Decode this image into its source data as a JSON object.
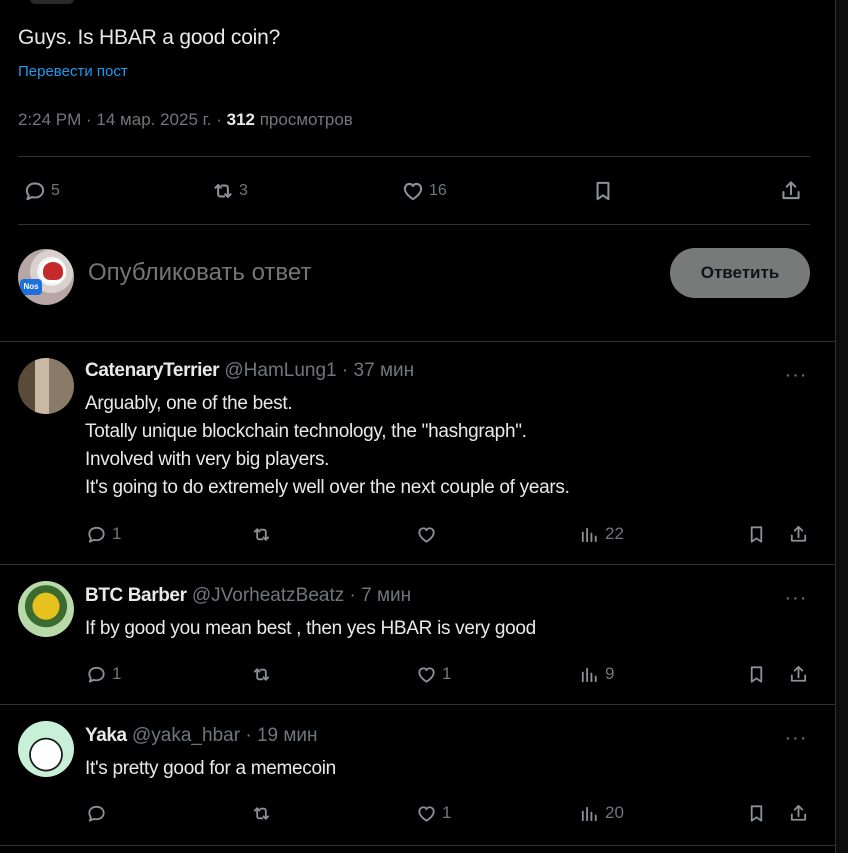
{
  "post": {
    "text": "Guys. Is HBAR a good coin?",
    "translate_label": "Перевести пост",
    "time": "2:24 PM",
    "date": "14 мар. 2025 г.",
    "views_count": "312",
    "views_label": "просмотров",
    "stats": {
      "replies": "5",
      "reposts": "3",
      "likes": "16"
    }
  },
  "composer": {
    "placeholder": "Опубликовать ответ",
    "badge_text": "Nos",
    "reply_button": "Ответить"
  },
  "replies": [
    {
      "name": "CatenaryTerrier",
      "handle": "@HamLung1",
      "time": "37 мин",
      "text": "Arguably, one of the best.\nTotally unique blockchain technology, the \"hashgraph\".\nInvolved with very big players.\nIt's going to do extremely well over the next couple of years.",
      "replies": "1",
      "reposts": "",
      "likes": "",
      "views": "22"
    },
    {
      "name": "BTC Barber",
      "handle": "@JVorheatzBeatz",
      "time": "7 мин",
      "text": "If by good you mean best , then yes HBAR is very good",
      "replies": "1",
      "reposts": "",
      "likes": "1",
      "views": "9"
    },
    {
      "name": "Yaka",
      "handle": "@yaka_hbar",
      "time": "19 мин",
      "text": "It's pretty good for a memecoin",
      "replies": "",
      "reposts": "",
      "likes": "1",
      "views": "20"
    }
  ],
  "separator": " · ",
  "more_label": "···",
  "colors": {
    "background": "#000000",
    "accent": "#1d9bf0",
    "muted": "#71767b",
    "text": "#e7e9ea",
    "border": "#2f3336"
  }
}
